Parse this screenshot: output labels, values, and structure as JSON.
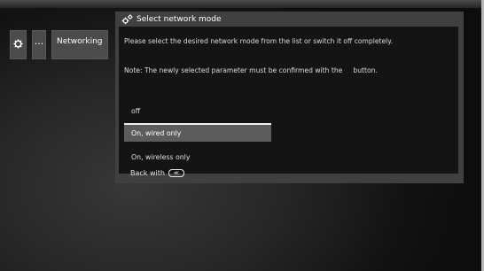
{
  "breadcrumb": {
    "dots_label": "...",
    "networking_label": "Networking"
  },
  "dialog": {
    "title": "Select network mode",
    "message": "Please select the desired network mode from the list or switch it off completely.",
    "note": "Note: The newly selected parameter must be confirmed with the     button.",
    "options": [
      {
        "label": "off",
        "selected": false
      },
      {
        "label": "On, wired only",
        "selected": true
      },
      {
        "label": "On, wireless only",
        "selected": false
      }
    ],
    "footer": {
      "back_label": "Back with",
      "back_icon": "back-button-icon"
    }
  },
  "icons": {
    "settings": "gear-icon",
    "dialog_title": "gears-icon"
  }
}
